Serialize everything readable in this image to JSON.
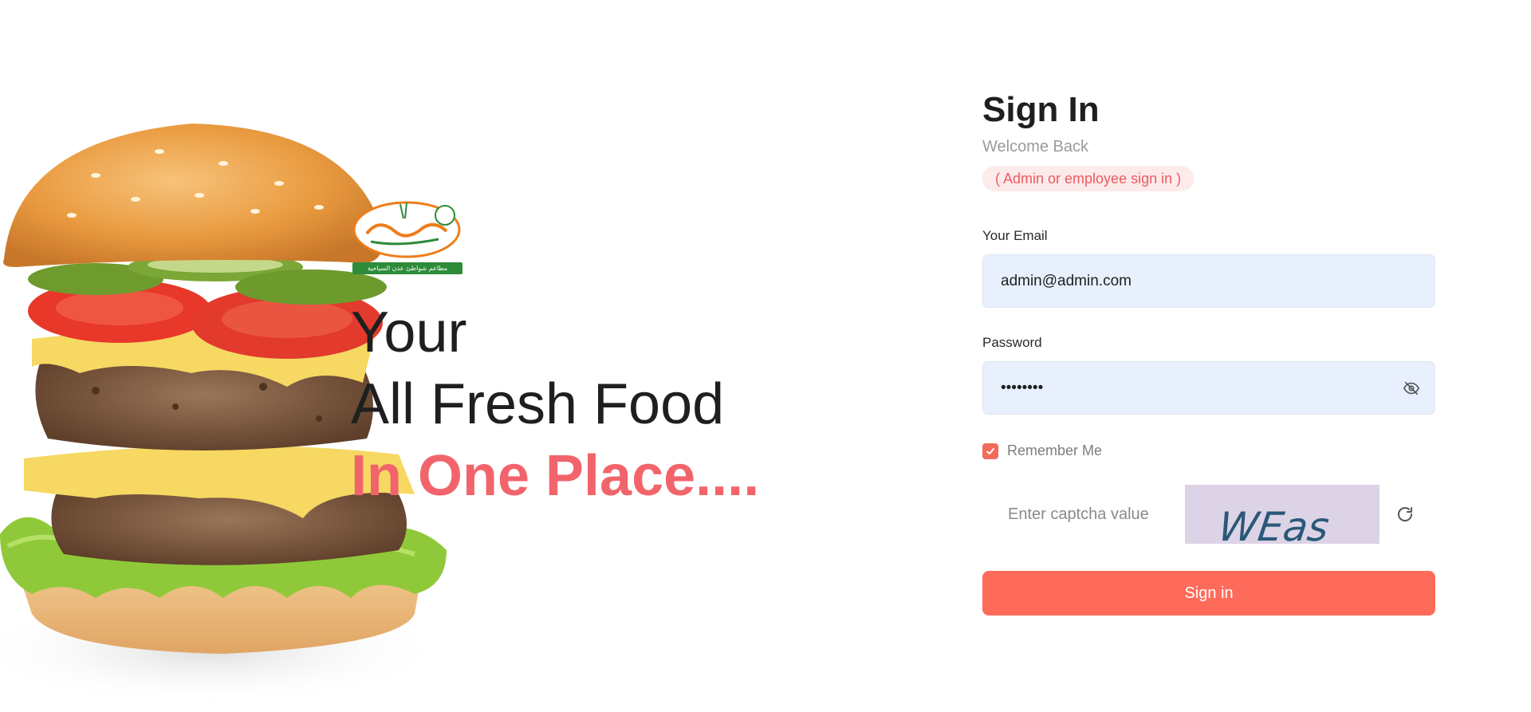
{
  "hero": {
    "logo": {
      "caption": "مطاعم شواطئ عدن السياحية",
      "name": "مطاعم شواطئ عدن"
    },
    "headline_line1": "Your",
    "headline_line2": "All Fresh Food",
    "headline_line3": "In One Place....",
    "accent_color": "#f2646b"
  },
  "form": {
    "title": "Sign In",
    "subtitle": "Welcome Back",
    "role_badge": "( Admin or employee sign in )",
    "email_label": "Your Email",
    "email_value": "admin@admin.com",
    "password_label": "Password",
    "password_value": "password",
    "remember_label": "Remember Me",
    "remember_checked": true,
    "captcha_placeholder": "Enter captcha value",
    "captcha_text": "WEas",
    "submit_label": "Sign in",
    "button_color": "#ff6b5a",
    "password_toggle_icon": "eye-off-icon",
    "refresh_icon": "refresh-icon"
  }
}
